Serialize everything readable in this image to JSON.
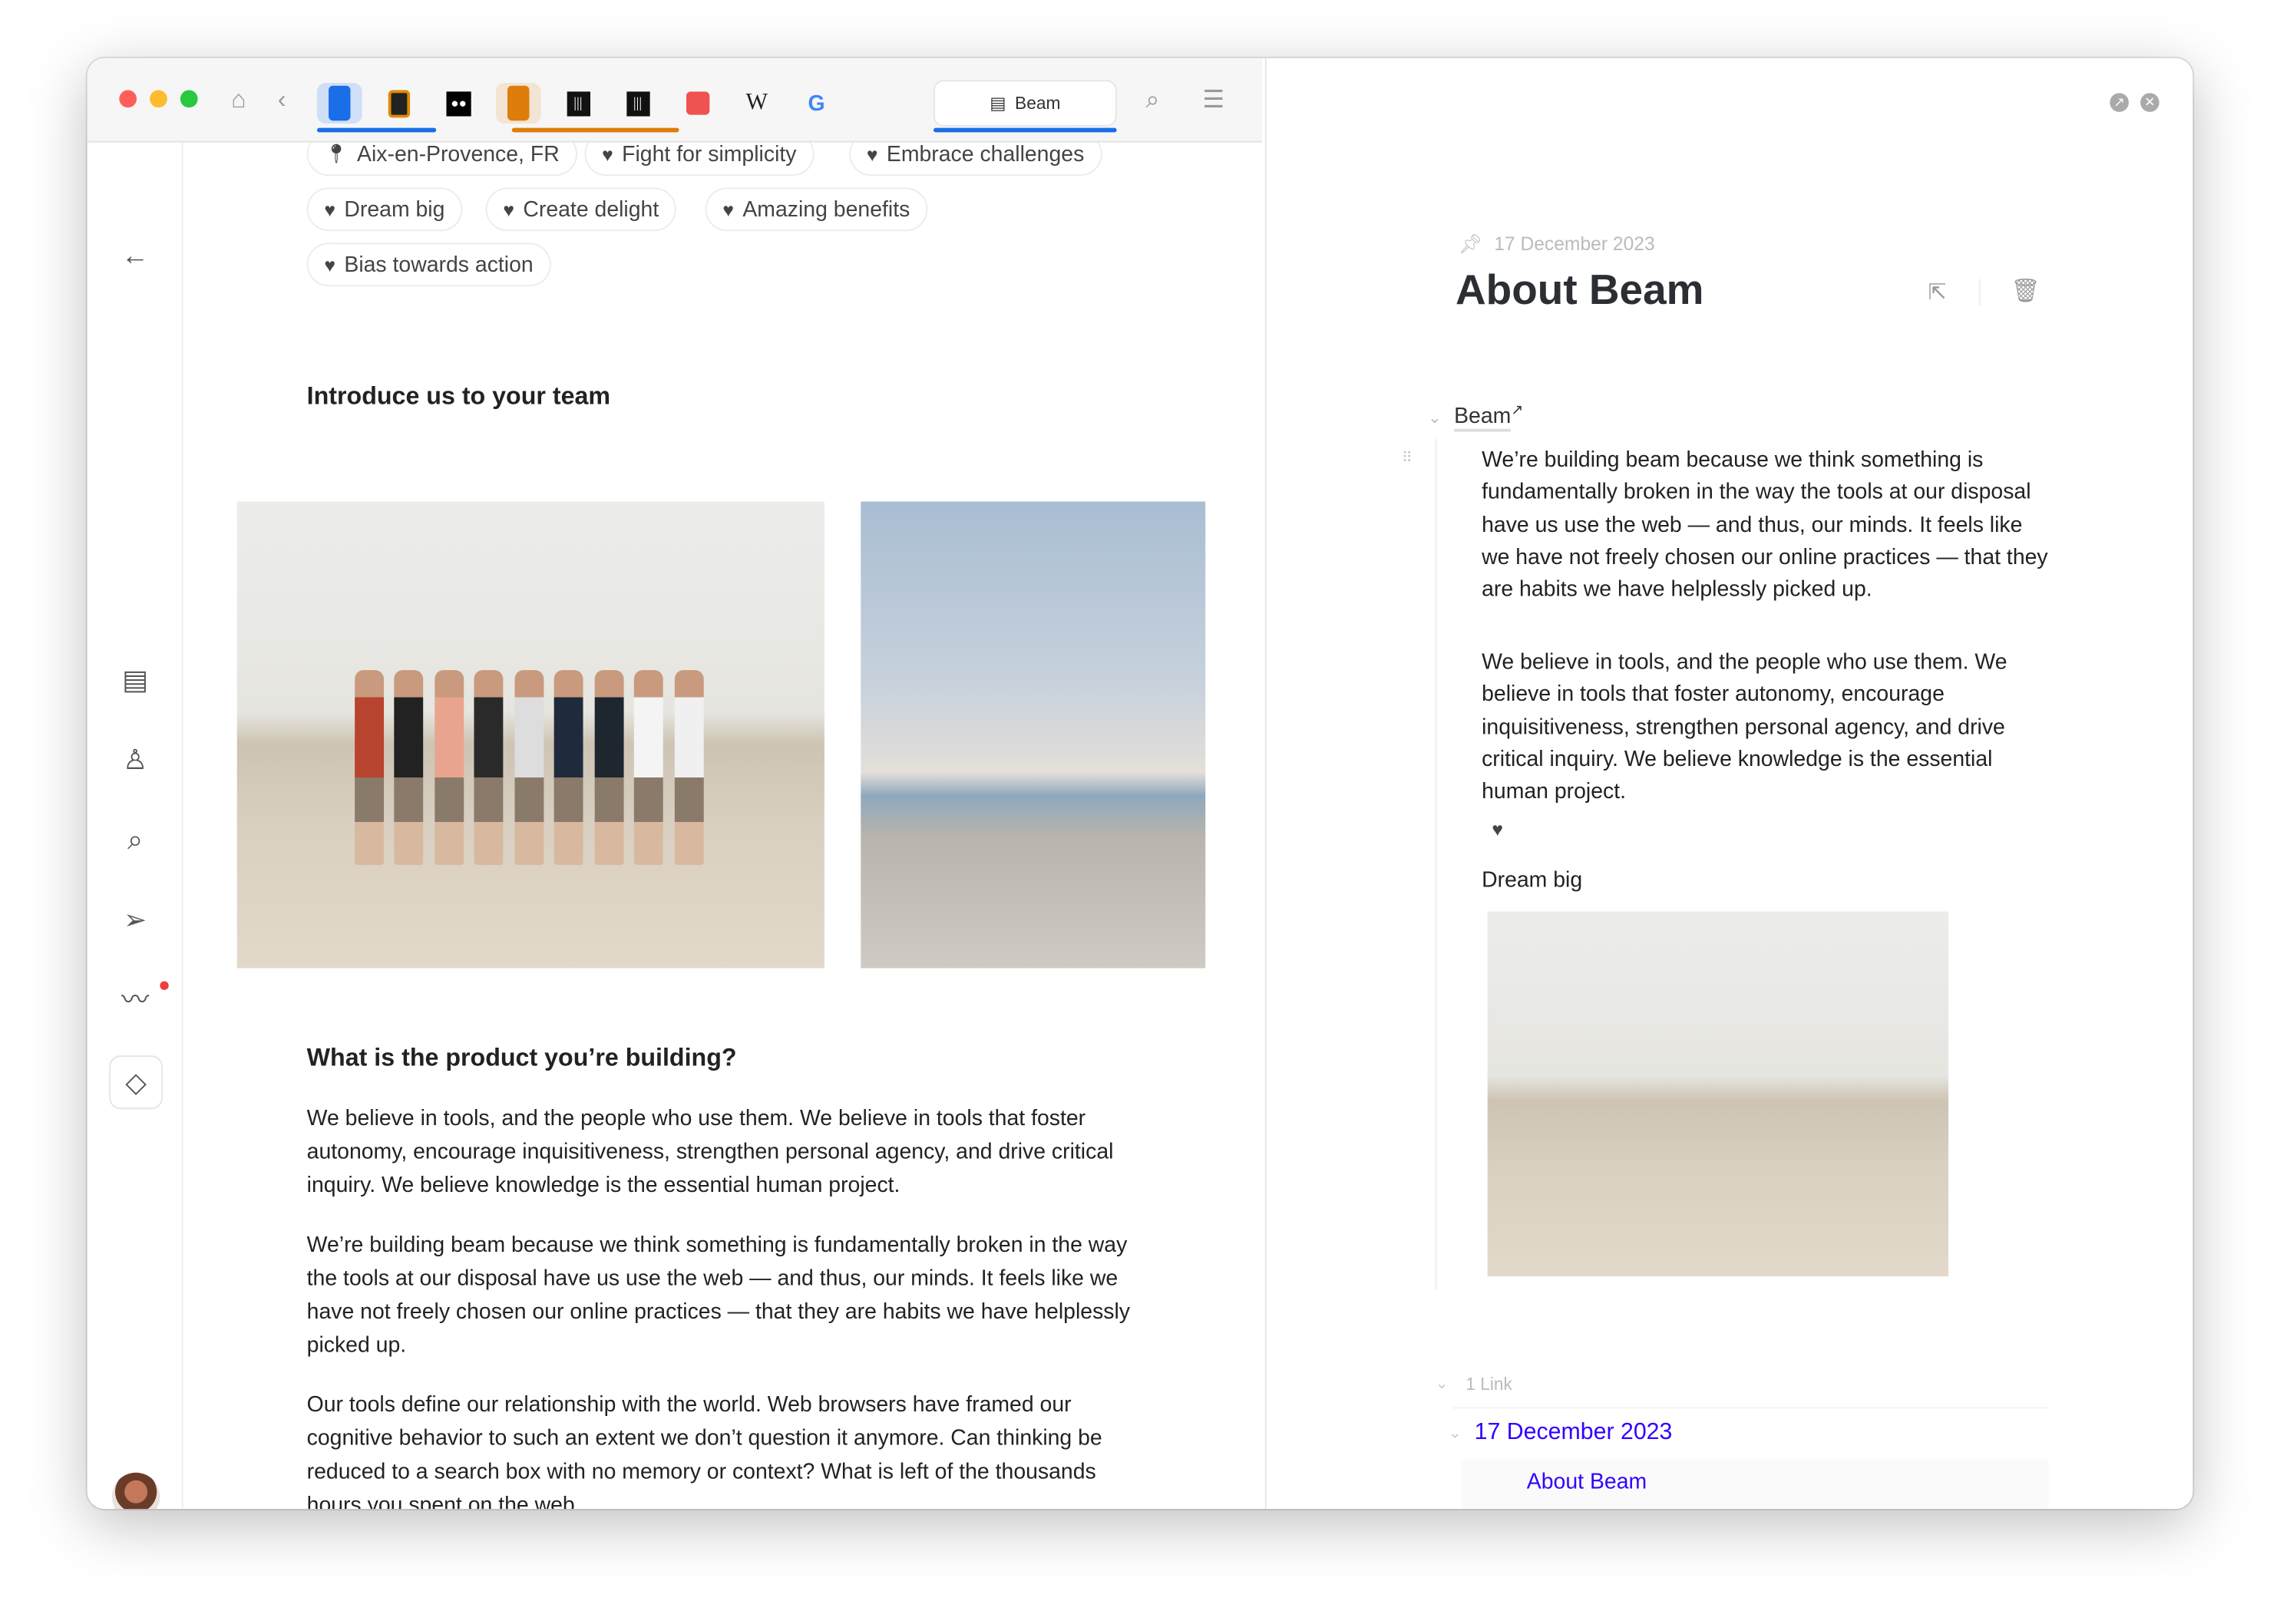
{
  "toolbar": {
    "active_tab_label": "Beam",
    "favicons": [
      "blue-app",
      "dark-app",
      "medium",
      "orange-app",
      "museum",
      "museum",
      "store",
      "W",
      "G"
    ]
  },
  "tags": [
    {
      "icon": "pin-icon",
      "label": "Aix-en-Provence, FR"
    },
    {
      "icon": "heart-icon",
      "label": "Fight for simplicity"
    },
    {
      "icon": "heart-icon",
      "label": "Embrace challenges"
    },
    {
      "icon": "heart-icon",
      "label": "Dream big"
    },
    {
      "icon": "heart-icon",
      "label": "Create delight"
    },
    {
      "icon": "heart-icon",
      "label": "Amazing benefits"
    },
    {
      "icon": "heart-icon",
      "label": "Bias towards action"
    }
  ],
  "left": {
    "team_heading": "Introduce us to your team",
    "product_heading": "What is the product you’re building?",
    "paragraphs": [
      "We believe in tools, and the people who use them. We believe in tools that foster autonomy, encourage inquisitiveness, strengthen personal agency, and drive critical inquiry. We believe knowledge is the essential human project.",
      "We’re building beam because we think something is fundamentally broken in the way the tools at our disposal have us use the web — and thus, our minds. It feels like we have not freely chosen our online practices — that they are habits we have helplessly picked up.",
      "Our tools define our relationship with the world. Web browsers have framed our cognitive behavior to such an extent we don’t question it anymore. Can thinking be reduced to a search box with no memory or context? What is left of the thousands hours you spent on the web"
    ]
  },
  "right": {
    "date": "17 December 2023",
    "title": "About Beam",
    "source_link": "Beam",
    "paragraphs": [
      "We’re building beam because we think something is fundamentally broken in the way the tools at our disposal have us use the web — and thus, our minds. It feels like we have not freely chosen our online practices — that they are habits we have helplessly picked up.",
      "We believe in tools, and the people who use them. We believe in tools that foster autonomy, encourage inquisitiveness, strengthen personal agency, and drive critical inquiry. We believe knowledge is the essential human project."
    ],
    "caption": "Dream big",
    "links_count": "1 Link",
    "link_date": "17 December 2023",
    "link_note": "About Beam"
  },
  "colors": {
    "accent": "#3300ff",
    "tab_blue": "#1a6ee8",
    "tab_orange": "#dd7d0b"
  }
}
